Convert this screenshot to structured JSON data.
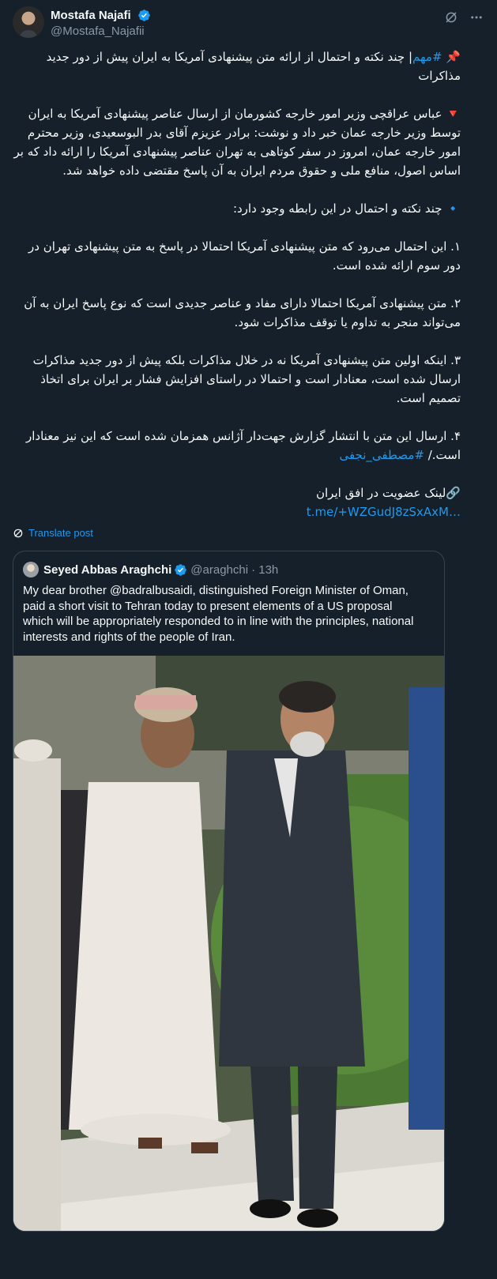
{
  "author": {
    "display_name": "Mostafa Najafi",
    "handle": "@Mostafa_Najafii"
  },
  "post": {
    "title_icon": "📌",
    "title_hashtag": "#مهم",
    "title_text": "| چند نکته و احتمال از ارائه متن پیشنهادی آمریکا به ایران پیش از دور جدید مذاکرات",
    "p1_icon": "🔻",
    "p1_text": "عباس عراقچی وزیر امور خارجه کشورمان از ارسال عناصر پیشنهادی آمریکا به ایران توسط وزیر خارجه عمان خبر داد و نوشت: برادر عزیزم آقای بدر البوسعیدی، وزیر محترم امور خارجه عمان، امروز در سفر کوتاهی به تهران عناصر پیشنهادی آمریکا را ارائه داد که بر اساس اصول، منافع ملی و حقوق مردم ایران به آن پاسخ مقتضی داده خواهد شد.",
    "p2_icon": "🔹",
    "p2_text": "چند نکته و احتمال در این رابطه وجود دارد:",
    "item1": "۱. این احتمال می‌رود که متن پیشنهادی آمریکا احتمالا در پاسخ به متن پیشنهادی تهران در دور سوم ارائه شده است.",
    "item2": "۲. متن پیشنهادی آمریکا احتمالا دارای مفاد و عناصر جدیدی است که نوع پاسخ ایران به آن می‌تواند منجر به تداوم یا توقف مذاکرات شود.",
    "item3": "۳. اینکه اولین متن پیشنهادی آمریکا نه در خلال مذاکرات بلکه پیش از دور جدید مذاکرات ارسال شده است، معنادار است و احتمالا در راستای افزایش فشار بر ایران برای اتخاذ تصمیم است.",
    "item4": "۴. ارسال این متن با انتشار گزارش جهت‌دار آژانس همزمان شده است که این نیز معنادار است./ ",
    "item4_hashtag": "#مصطفی_نجفی",
    "link_icon": "🔗",
    "link_label": "لینک عضویت در افق ایران",
    "link_url": "t.me/+WZGudJ8zSxAxM…"
  },
  "translate_label": "Translate post",
  "quote": {
    "display_name": "Seyed Abbas Araghchi",
    "handle": "@araghchi",
    "time": "· 13h",
    "text": "My dear brother @badralbusaidi, distinguished Foreign Minister of Oman, paid a short visit to Tehran today to present elements of a US proposal which will be appropriately responded to in line with the principles, national interests and rights of the people of Iran."
  },
  "colors": {
    "background": "#15202b",
    "text": "#f7f9f9",
    "muted": "#8b98a5",
    "accent": "#1d9bf0",
    "border": "#38444d"
  }
}
